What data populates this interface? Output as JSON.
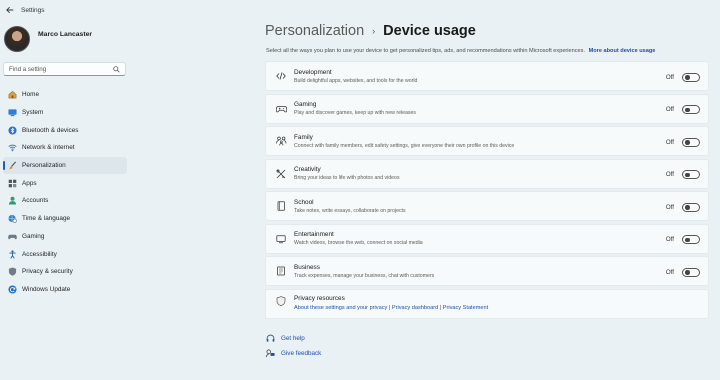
{
  "app": {
    "title": "Settings"
  },
  "profile": {
    "name": "Marco Lancaster"
  },
  "search": {
    "placeholder": "Find a setting"
  },
  "sidebar": {
    "items": [
      {
        "label": "Home",
        "icon": "home-icon"
      },
      {
        "label": "System",
        "icon": "monitor-icon"
      },
      {
        "label": "Bluetooth & devices",
        "icon": "bluetooth-icon"
      },
      {
        "label": "Network & internet",
        "icon": "network-icon"
      },
      {
        "label": "Personalization",
        "icon": "brush-icon",
        "active": true
      },
      {
        "label": "Apps",
        "icon": "apps-icon"
      },
      {
        "label": "Accounts",
        "icon": "person-icon"
      },
      {
        "label": "Time & language",
        "icon": "globe-clock-icon"
      },
      {
        "label": "Gaming",
        "icon": "gamepad-icon"
      },
      {
        "label": "Accessibility",
        "icon": "accessibility-icon"
      },
      {
        "label": "Privacy & security",
        "icon": "shield-icon"
      },
      {
        "label": "Windows Update",
        "icon": "update-icon"
      }
    ]
  },
  "breadcrumb": {
    "parent": "Personalization",
    "separator": "›",
    "current": "Device usage"
  },
  "intro": {
    "text": "Select all the ways you plan to use your device to get personalized tips, ads, and recommendations within Microsoft experiences.",
    "link": "More about device usage"
  },
  "cards": [
    {
      "title": "Development",
      "desc": "Build delightful apps, websites, and tools for the world",
      "state": "Off",
      "icon": "code-icon"
    },
    {
      "title": "Gaming",
      "desc": "Play and discover games, keep up with new releases",
      "state": "Off",
      "icon": "gamepad-icon"
    },
    {
      "title": "Family",
      "desc": "Connect with family members, edit safety settings, give everyone their own profile on this device",
      "state": "Off",
      "icon": "family-icon"
    },
    {
      "title": "Creativity",
      "desc": "Bring your ideas to life with photos and videos",
      "state": "Off",
      "icon": "creativity-icon"
    },
    {
      "title": "School",
      "desc": "Take notes, write essays, collaborate on projects",
      "state": "Off",
      "icon": "notebook-icon"
    },
    {
      "title": "Entertainment",
      "desc": "Watch videos, browse the web, connect on social media",
      "state": "Off",
      "icon": "tv-icon"
    },
    {
      "title": "Business",
      "desc": "Track expenses, manage your business, chat with customers",
      "state": "Off",
      "icon": "briefcase-icon"
    }
  ],
  "resources": {
    "title": "Privacy resources",
    "links": [
      "About these settings and your privacy",
      "Privacy dashboard",
      "Privacy Statement"
    ],
    "separator": " | "
  },
  "help": {
    "get_help": "Get help",
    "give_feedback": "Give feedback"
  },
  "colors": {
    "accent": "#1d5fbf",
    "link": "#1d4fa8",
    "background": "#eaf1f4",
    "card": "#f6fafb"
  }
}
